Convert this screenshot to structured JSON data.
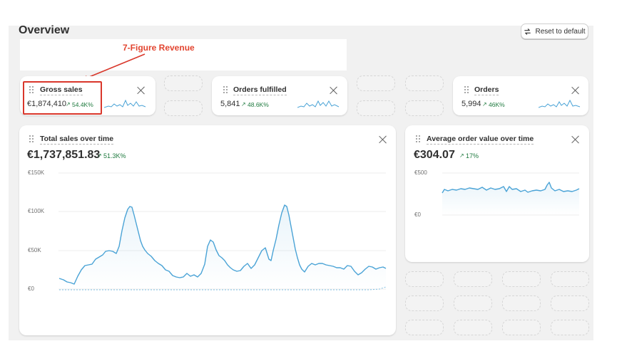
{
  "header": {
    "title": "Overview",
    "reset_label": "Reset to default"
  },
  "annotation": {
    "label": "7-Figure Revenue",
    "color": "#e2442f"
  },
  "cards": {
    "gross_sales": {
      "title": "Gross sales",
      "value": "€1,874,410",
      "delta": "54.4K%"
    },
    "orders_fulfilled": {
      "title": "Orders fulfilled",
      "value": "5,841",
      "delta": "48.6K%"
    },
    "orders": {
      "title": "Orders",
      "value": "5,994",
      "delta": "46K%"
    },
    "total_sales": {
      "title": "Total sales over time",
      "value": "€1,737,851.83",
      "delta": "51.3K%",
      "y_ticks": [
        "€150K",
        "€100K",
        "€50K",
        "€0"
      ]
    },
    "aov": {
      "title": "Average order value over time",
      "value": "€304.07",
      "delta": "17%",
      "y_ticks": [
        "€500",
        "€0"
      ]
    }
  },
  "colors": {
    "accent_line": "#4aa3d6",
    "positive": "#1f7a3f",
    "annotation": "#d9372b"
  },
  "icons": [
    "refresh-icon",
    "drag-handle-icon",
    "close-icon",
    "arrow-up-right-icon"
  ]
}
